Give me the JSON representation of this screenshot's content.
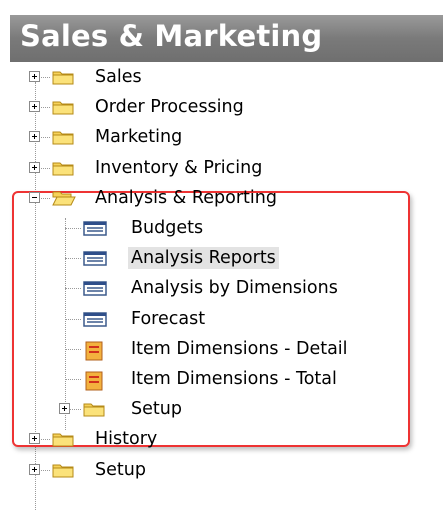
{
  "header": {
    "title": "Sales & Marketing"
  },
  "tree": {
    "items": [
      {
        "label": "Sales",
        "icon": "folder-icon",
        "expander": "plus"
      },
      {
        "label": "Order Processing",
        "icon": "folder-icon",
        "expander": "plus"
      },
      {
        "label": "Marketing",
        "icon": "folder-icon",
        "expander": "plus"
      },
      {
        "label": "Inventory & Pricing",
        "icon": "folder-icon",
        "expander": "plus"
      },
      {
        "label": "Analysis & Reporting",
        "icon": "open-folder-icon",
        "expander": "minus",
        "children": [
          {
            "label": "Budgets",
            "icon": "form-icon"
          },
          {
            "label": "Analysis Reports",
            "icon": "form-icon",
            "selected": true
          },
          {
            "label": "Analysis by Dimensions",
            "icon": "form-icon"
          },
          {
            "label": "Forecast",
            "icon": "form-icon"
          },
          {
            "label": "Item Dimensions - Detail",
            "icon": "report-icon"
          },
          {
            "label": "Item Dimensions - Total",
            "icon": "report-icon"
          },
          {
            "label": "Setup",
            "icon": "folder-icon",
            "expander": "plus"
          }
        ]
      },
      {
        "label": "History",
        "icon": "folder-icon",
        "expander": "plus"
      },
      {
        "label": "Setup",
        "icon": "folder-icon",
        "expander": "plus"
      }
    ]
  },
  "colors": {
    "header_bg": "#7f7f7f",
    "highlight_border": "#e33333",
    "selection_bg": "#e3e3e3"
  }
}
